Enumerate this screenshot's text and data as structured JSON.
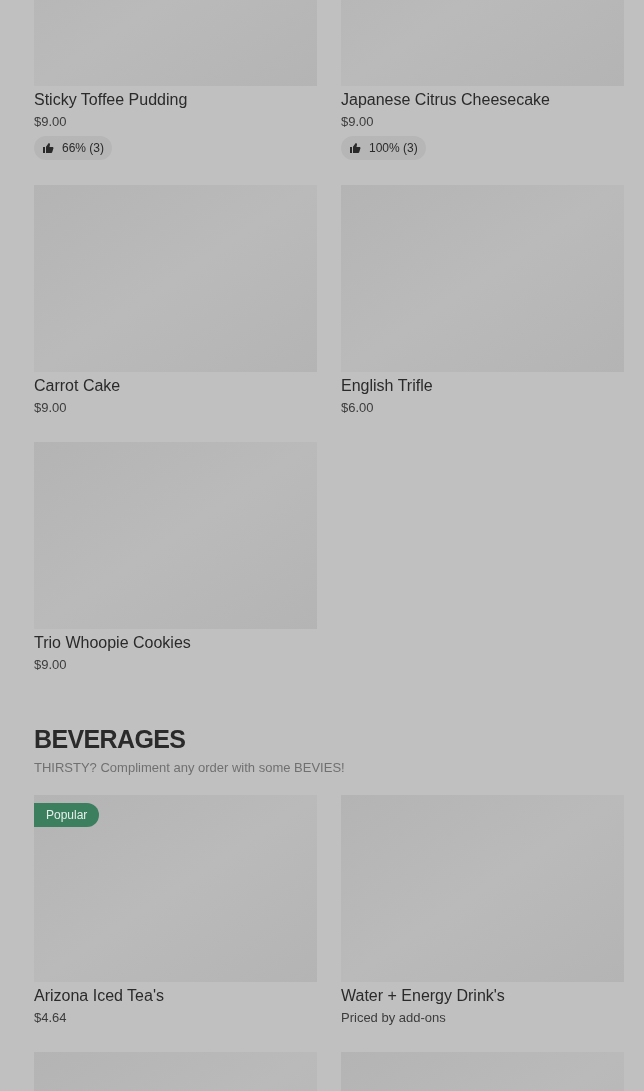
{
  "sections": [
    {
      "items": [
        {
          "kind": "product",
          "name": "Sticky Toffee Pudding",
          "price": "$9.00",
          "rating": "66% (3)"
        },
        {
          "kind": "product",
          "name": "Japanese Citrus Cheesecake",
          "price": "$9.00",
          "rating": "100% (3)"
        },
        {
          "kind": "product",
          "name": "Carrot Cake",
          "price": "$9.00"
        },
        {
          "kind": "product",
          "name": "English Trifle",
          "price": "$6.00"
        },
        {
          "kind": "product",
          "name": "Trio Whoopie Cookies",
          "price": "$9.00"
        }
      ]
    },
    {
      "title": "BEVERAGES",
      "description": "THIRSTY? Compliment any order with some BEVIES!",
      "items": [
        {
          "kind": "product",
          "name": "Arizona Iced Tea's",
          "price": "$4.64",
          "badge": "Popular"
        },
        {
          "kind": "product",
          "name": "Water + Energy Drink's",
          "price": "Priced by add-ons"
        },
        {
          "kind": "picture"
        },
        {
          "kind": "picture"
        }
      ]
    }
  ]
}
